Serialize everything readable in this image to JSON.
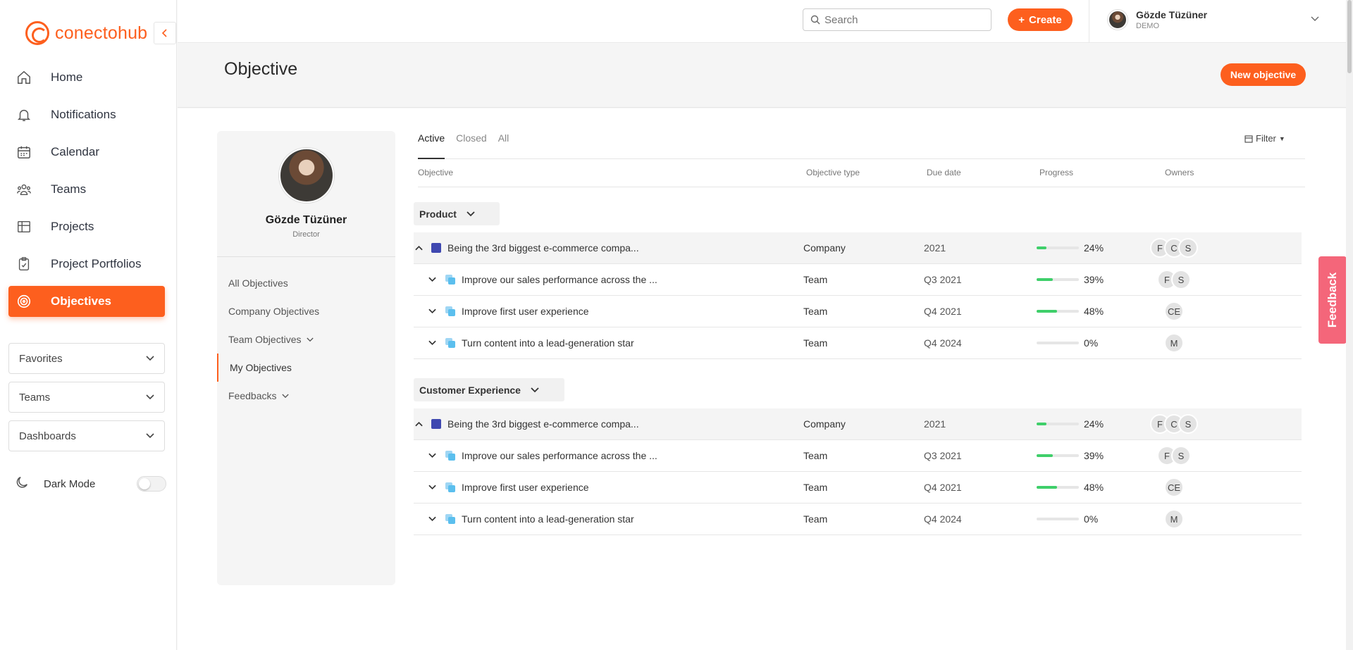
{
  "brand": {
    "name": "conectohub",
    "accent": "#fd5f1e"
  },
  "sidebar": {
    "nav": [
      {
        "label": "Home",
        "icon": "home-icon"
      },
      {
        "label": "Notifications",
        "icon": "bell-icon"
      },
      {
        "label": "Calendar",
        "icon": "calendar-icon"
      },
      {
        "label": "Teams",
        "icon": "teams-icon"
      },
      {
        "label": "Projects",
        "icon": "grid-icon"
      },
      {
        "label": "Project Portfolios",
        "icon": "clipboard-icon"
      },
      {
        "label": "Objectives",
        "icon": "target-icon"
      }
    ],
    "dropdowns": [
      "Favorites",
      "Teams",
      "Dashboards"
    ],
    "dark_mode_label": "Dark Mode"
  },
  "topbar": {
    "search_placeholder": "Search",
    "create_label": "Create",
    "user_name": "Gözde Tüzüner",
    "user_role": "DEMO"
  },
  "header": {
    "title": "Objective",
    "new_objective_label": "New objective"
  },
  "profile": {
    "name": "Gözde Tüzüner",
    "role": "Director",
    "menu": [
      {
        "label": "All Objectives",
        "chevron": false
      },
      {
        "label": "Company Objectives",
        "chevron": false
      },
      {
        "label": "Team Objectives",
        "chevron": true
      },
      {
        "label": "My Objectives",
        "chevron": false
      },
      {
        "label": "Feedbacks",
        "chevron": true
      }
    ]
  },
  "tabs": [
    "Active",
    "Closed",
    "All"
  ],
  "filter_label": "Filter",
  "columns": [
    "Objective",
    "Objective type",
    "Due date",
    "Progress",
    "Owners"
  ],
  "groups": [
    {
      "name": "Product",
      "rows": [
        {
          "name": "Being the 3rd biggest e-commerce compa...",
          "type": "Company",
          "due": "2021",
          "progress": 24,
          "pct": "24%",
          "owners": [
            "F",
            "C",
            "S"
          ]
        },
        {
          "name": "Improve our sales performance across the ...",
          "type": "Team",
          "due": "Q3 2021",
          "progress": 39,
          "pct": "39%",
          "owners": [
            "F",
            "S"
          ]
        },
        {
          "name": "Improve first user experience",
          "type": "Team",
          "due": "Q4 2021",
          "progress": 48,
          "pct": "48%",
          "owners": [
            "CE"
          ]
        },
        {
          "name": "Turn content into a lead-generation star",
          "type": "Team",
          "due": "Q4 2024",
          "progress": 0,
          "pct": "0%",
          "owners": [
            "M"
          ]
        }
      ]
    },
    {
      "name": "Customer Experience",
      "rows": [
        {
          "name": "Being the 3rd biggest e-commerce compa...",
          "type": "Company",
          "due": "2021",
          "progress": 24,
          "pct": "24%",
          "owners": [
            "F",
            "C",
            "S"
          ]
        },
        {
          "name": "Improve our sales performance across the ...",
          "type": "Team",
          "due": "Q3 2021",
          "progress": 39,
          "pct": "39%",
          "owners": [
            "F",
            "S"
          ]
        },
        {
          "name": "Improve first user experience",
          "type": "Team",
          "due": "Q4 2021",
          "progress": 48,
          "pct": "48%",
          "owners": [
            "CE"
          ]
        },
        {
          "name": "Turn content into a lead-generation star",
          "type": "Team",
          "due": "Q4 2024",
          "progress": 0,
          "pct": "0%",
          "owners": [
            "M"
          ]
        }
      ]
    }
  ],
  "feedback_label": "Feedback"
}
